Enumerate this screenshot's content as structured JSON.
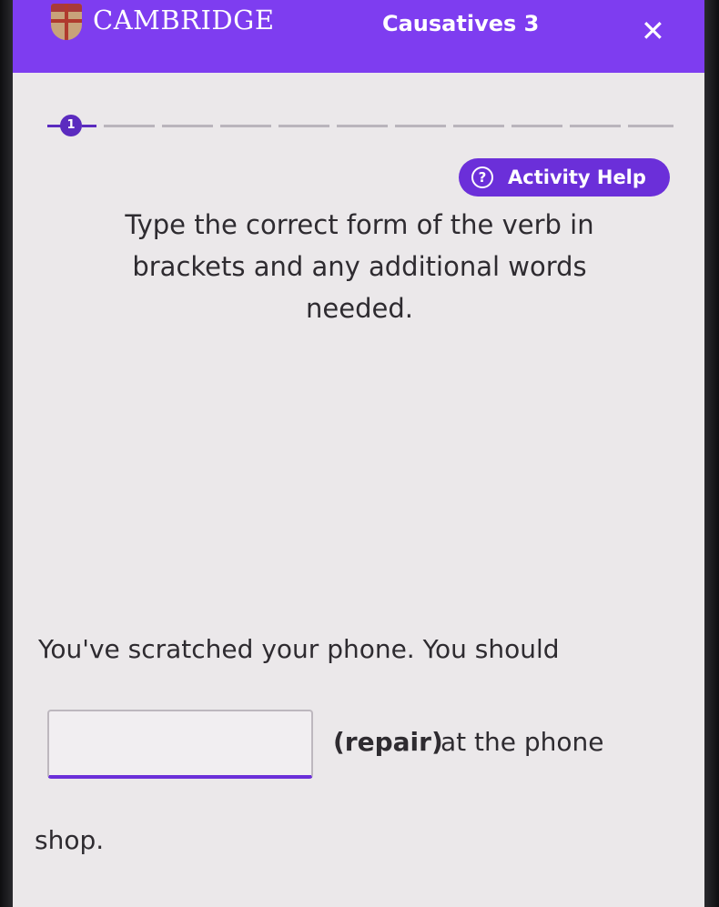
{
  "header": {
    "brand": "CAMBRIDGE",
    "activity_title": "Causatives 3",
    "close_glyph": "✕"
  },
  "progress": {
    "current_step": "1",
    "total_steps": 10
  },
  "help": {
    "icon_glyph": "?",
    "label": "Activity Help"
  },
  "instructions": "Type the correct form of the verb in brackets and any additional words needed.",
  "question": {
    "before": "You've scratched your phone. You should",
    "answer_value": "",
    "hint": "(repair)",
    "after": "at the phone",
    "end": "shop."
  },
  "colors": {
    "brand_purple": "#7e3df0",
    "accent_purple": "#6b2fd9",
    "background": "#ebe8ea"
  }
}
